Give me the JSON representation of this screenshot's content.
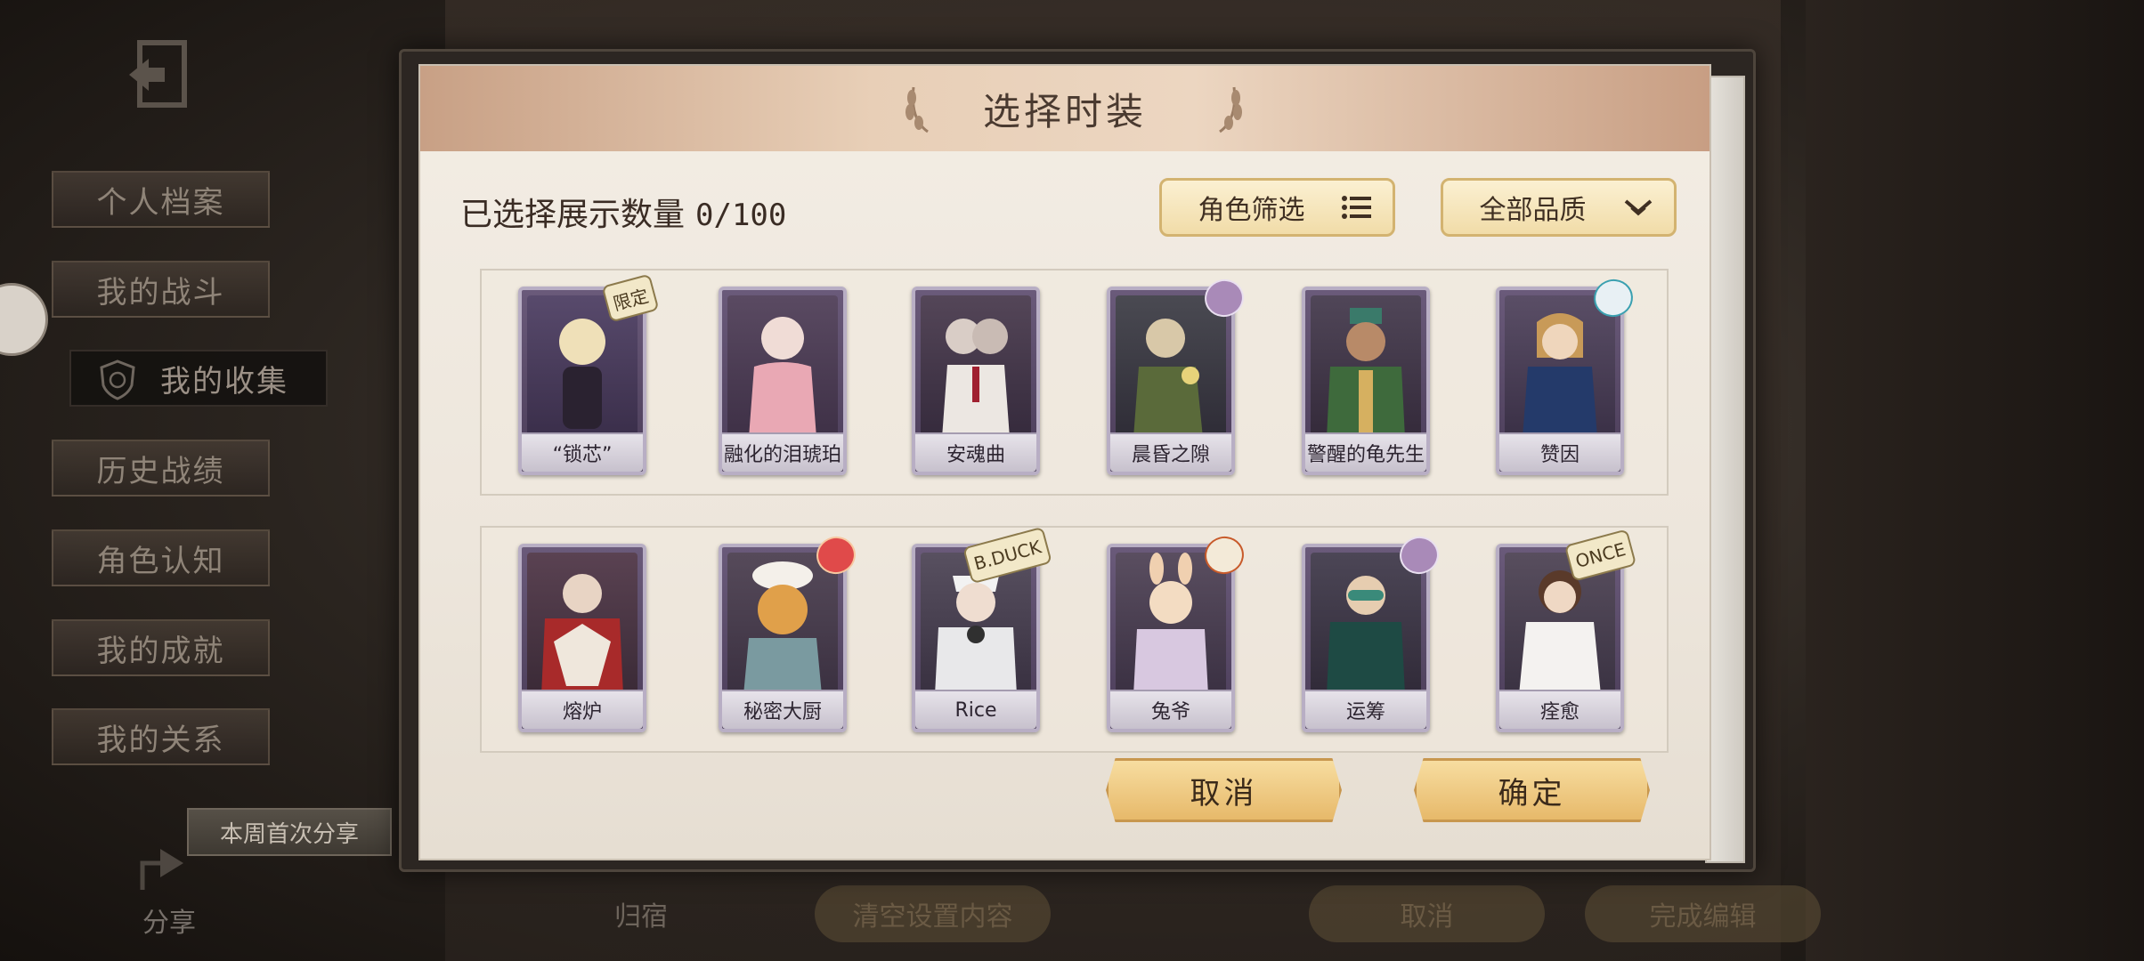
{
  "sidebar": {
    "items": [
      {
        "label": "个人档案"
      },
      {
        "label": "我的战斗"
      },
      {
        "label": "我的收集"
      },
      {
        "label": "历史战绩"
      },
      {
        "label": "角色认知"
      },
      {
        "label": "我的成就"
      },
      {
        "label": "我的关系"
      }
    ],
    "active_index": 2,
    "share_tip": "本周首次分享",
    "share_label": "分享"
  },
  "background_bar": {
    "home": "归宿",
    "clear": "清空设置内容",
    "cancel": "取消",
    "finish": "完成编辑"
  },
  "modal": {
    "title": "选择时装",
    "selected_label": "已选择展示数量",
    "selected_count": "0/100",
    "role_filter": "角色筛选",
    "quality_filter": "全部品质",
    "cards": [
      {
        "name": "“锁芯”",
        "badge": "限定"
      },
      {
        "name": "融化的泪琥珀",
        "badge": ""
      },
      {
        "name": "安魂曲",
        "badge": ""
      },
      {
        "name": "晨昏之隙",
        "badge": ""
      },
      {
        "name": "警醒的龟先生",
        "badge": ""
      },
      {
        "name": "赞因",
        "badge": ""
      },
      {
        "name": "熔炉",
        "badge": ""
      },
      {
        "name": "秘密大厨",
        "badge": ""
      },
      {
        "name": "Rice",
        "badge": "B.DUCK"
      },
      {
        "name": "兔爷",
        "badge": ""
      },
      {
        "name": "运筹",
        "badge": ""
      },
      {
        "name": "痊愈",
        "badge": "ONCE"
      }
    ],
    "cancel_button": "取消",
    "confirm_button": "确定"
  },
  "colors": {
    "header_gradient_mid": "#ecd6c1",
    "button_gold": "#e7b96a",
    "card_purple": "#4a3c58"
  }
}
